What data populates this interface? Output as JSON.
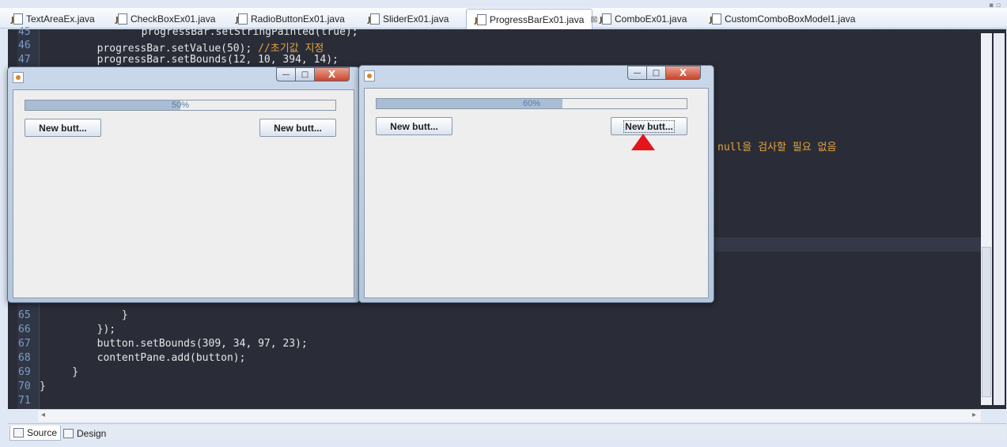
{
  "tabs": [
    {
      "label": "TextAreaEx.java",
      "active": false
    },
    {
      "label": "CheckBoxEx01.java",
      "active": false
    },
    {
      "label": "RadioButtonEx01.java",
      "active": false
    },
    {
      "label": "SliderEx01.java",
      "active": false
    },
    {
      "label": "ProgressBarEx01.java",
      "active": true
    },
    {
      "label": "ComboEx01.java",
      "active": false
    },
    {
      "label": "CustomComboBoxModel1.java",
      "active": false
    }
  ],
  "close_glyph": "⊠",
  "editor": {
    "top_lines": [
      {
        "num": "45",
        "code": "        progressBar.setStringPainted(true);",
        "comment": ""
      },
      {
        "num": "46",
        "code": "        progressBar.setValue(50); ",
        "comment": "//초기값 지정"
      },
      {
        "num": "47",
        "code": "        progressBar.setBounds(12, 10, 394, 14);",
        "comment": ""
      }
    ],
    "side_comment": "null을 검사할 필요 없음",
    "bottom_lines": [
      {
        "num": "65",
        "code": "            }"
      },
      {
        "num": "66",
        "code": "        });"
      },
      {
        "num": "67",
        "code": "        button.setBounds(309, 34, 97, 23);"
      },
      {
        "num": "68",
        "code": "        contentPane.add(button);"
      },
      {
        "num": "69",
        "code": "    }"
      },
      {
        "num": "70",
        "code": "}"
      },
      {
        "num": "71",
        "code": ""
      }
    ]
  },
  "bottom_tabs": [
    {
      "label": "Source",
      "active": true
    },
    {
      "label": "Design",
      "active": false
    }
  ],
  "windows": [
    {
      "progress_text": "50%",
      "progress_value": 0.5,
      "button_left": "New butt...",
      "button_right": "New butt..."
    },
    {
      "progress_text": "60%",
      "progress_value": 0.6,
      "button_left": "New butt...",
      "button_right": "New butt..."
    }
  ],
  "window_controls": {
    "min": "—",
    "max": "□",
    "close": "X"
  },
  "colors": {
    "progress_fill": "#a9bdd4",
    "annotation_arrow": "#e4141b",
    "editor_bg": "#2a2d38"
  }
}
